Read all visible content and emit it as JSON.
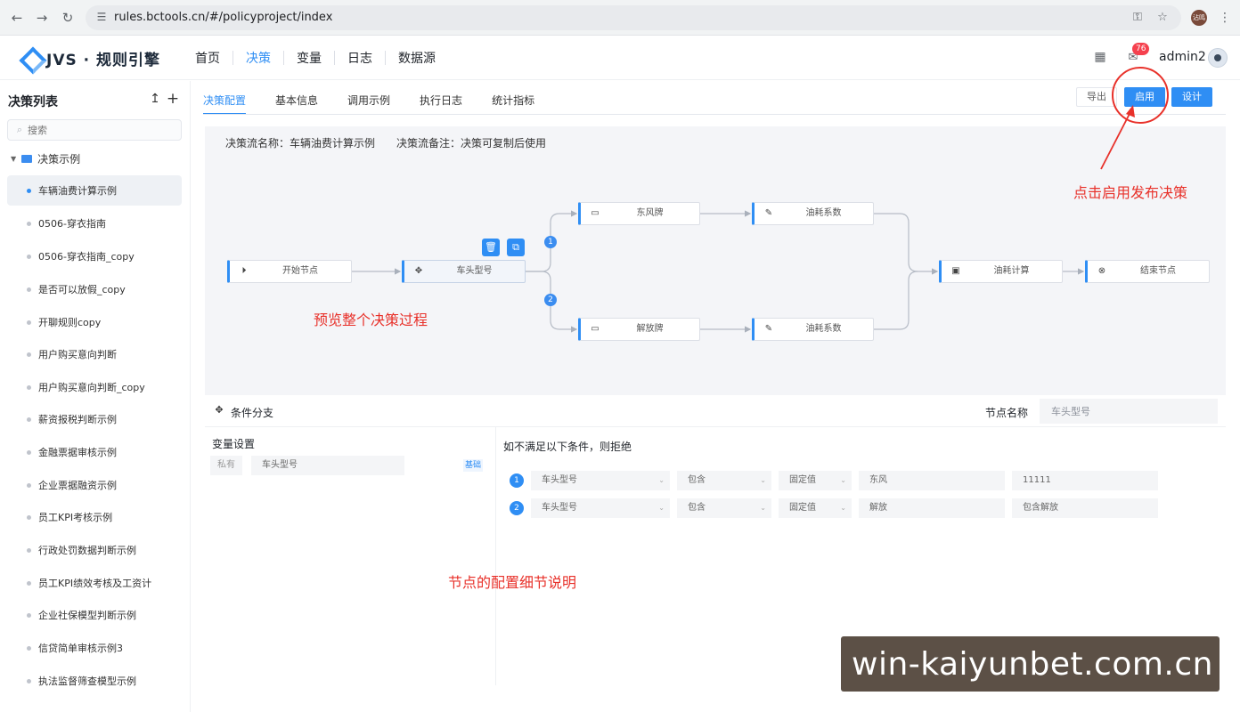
{
  "browser": {
    "url": "rules.bctools.cn/#/policyproject/index",
    "profile_label": "沾鸣"
  },
  "header": {
    "logo_text": "JVS · 规则引擎",
    "nav": [
      {
        "label": "首页",
        "active": false
      },
      {
        "label": "决策",
        "active": true
      },
      {
        "label": "变量",
        "active": false
      },
      {
        "label": "日志",
        "active": false
      },
      {
        "label": "数据源",
        "active": false
      }
    ],
    "message_count": "76",
    "username": "admin2"
  },
  "sidebar": {
    "title": "决策列表",
    "search_placeholder": "搜索",
    "root_folder": "决策示例",
    "items": [
      {
        "label": "车辆油费计算示例",
        "active": true
      },
      {
        "label": "0506-穿衣指南"
      },
      {
        "label": "0506-穿衣指南_copy"
      },
      {
        "label": "是否可以放假_copy"
      },
      {
        "label": "开聊规则copy"
      },
      {
        "label": "用户购买意向判断"
      },
      {
        "label": "用户购买意向判断_copy"
      },
      {
        "label": "薪资报税判断示例"
      },
      {
        "label": "金融票据审核示例"
      },
      {
        "label": "企业票据融资示例"
      },
      {
        "label": "员工KPI考核示例"
      },
      {
        "label": "行政处罚数据判断示例"
      },
      {
        "label": "员工KPI绩效考核及工资计"
      },
      {
        "label": "企业社保模型判断示例"
      },
      {
        "label": "信贷简单审核示例3"
      },
      {
        "label": "执法监督筛查模型示例"
      }
    ]
  },
  "tabs": [
    {
      "label": "决策配置",
      "active": true
    },
    {
      "label": "基本信息"
    },
    {
      "label": "调用示例"
    },
    {
      "label": "执行日志"
    },
    {
      "label": "统计指标"
    }
  ],
  "actions": {
    "export": "导出",
    "enable": "启用",
    "design": "设计"
  },
  "flow": {
    "name_text": "决策流名称：车辆油费计算示例",
    "remark_text": "决策流备注：决策可复制后使用",
    "nodes": {
      "start": {
        "label": "开始节点",
        "icon": "play-circle-icon"
      },
      "head_model": {
        "label": "车头型号",
        "icon": "move-icon"
      },
      "dongfeng": {
        "label": "东风牌",
        "icon": "card-icon"
      },
      "oil_coef_1": {
        "label": "油耗系数",
        "icon": "edit-icon"
      },
      "jiefang": {
        "label": "解放牌",
        "icon": "card-icon"
      },
      "oil_coef_2": {
        "label": "油耗系数",
        "icon": "edit-icon"
      },
      "oil_calc": {
        "label": "油耗计算",
        "icon": "calculator-icon"
      },
      "end": {
        "label": "结束节点",
        "icon": "stop-circle-icon"
      }
    },
    "branches": [
      "1",
      "2"
    ]
  },
  "config": {
    "title": "条件分支",
    "node_name_label": "节点名称",
    "node_name_value": "车头型号",
    "var_title": "变量设置",
    "var_scope": "私有",
    "var_name": "车头型号",
    "var_type": "基础",
    "rule_title": "如不满足以下条件，则拒绝",
    "rules": [
      {
        "num": "1",
        "field": "车头型号",
        "op": "包含",
        "mode": "固定值",
        "value": "东风",
        "extra": "11111"
      },
      {
        "num": "2",
        "field": "车头型号",
        "op": "包含",
        "mode": "固定值",
        "value": "解放",
        "extra": "包含解放"
      }
    ]
  },
  "annotations": {
    "publish": "点击启用发布决策",
    "preview": "预览整个决策过程",
    "details": "节点的配置细节说明"
  },
  "watermark": "win-kaiyunbet.com.cn",
  "colors": {
    "accent": "#2f8ef4",
    "annotation": "#e8312a",
    "badge": "#f5414e"
  }
}
